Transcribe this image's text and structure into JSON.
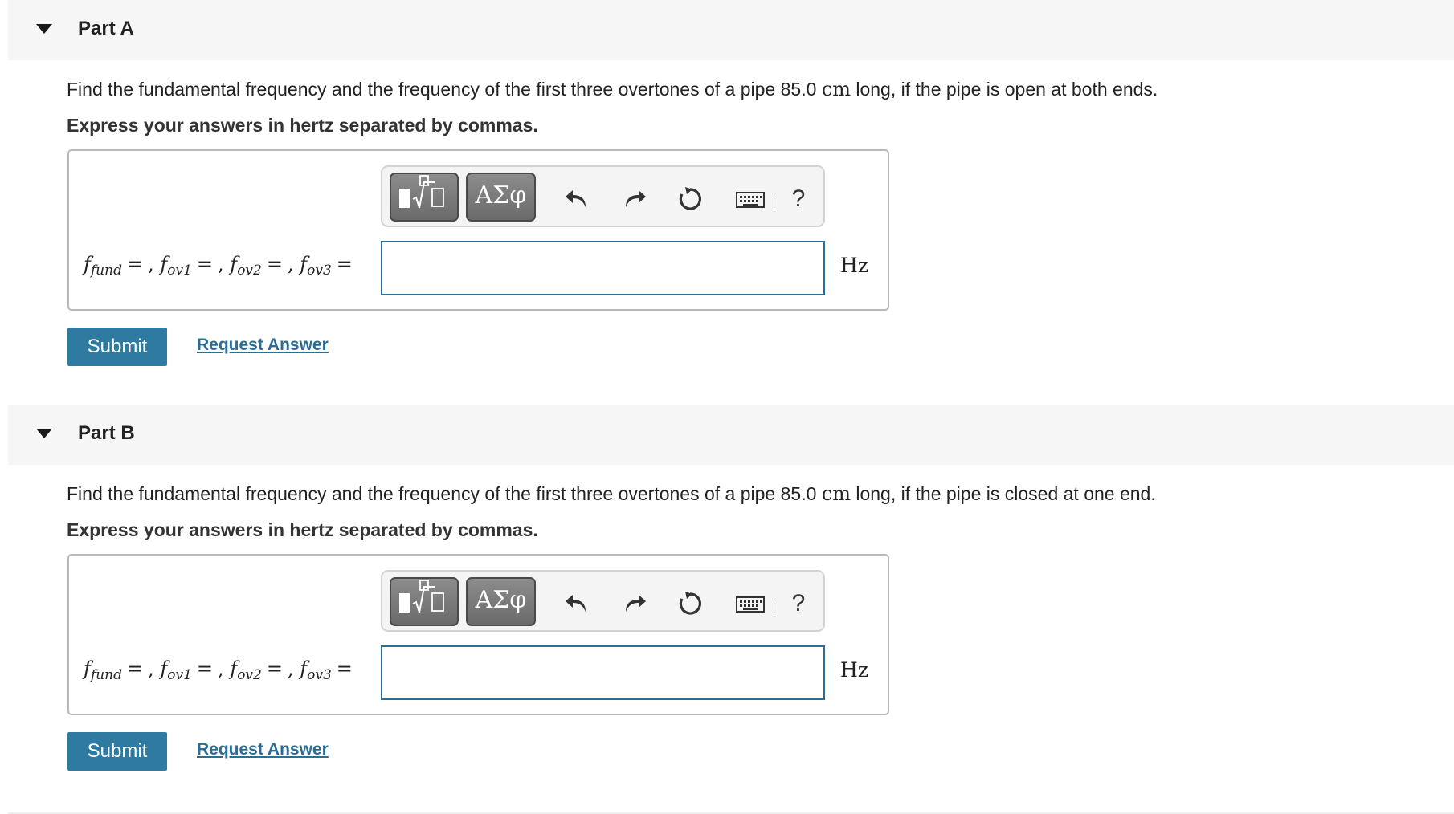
{
  "parts": [
    {
      "title": "Part A",
      "question_before": "Find the fundamental frequency and the frequency of the first three overtones of a pipe 85.0 ",
      "question_unit": "cm",
      "question_after": " long, if the pipe is open at both ends.",
      "instruction": "Express your answers in hertz separated by commas.",
      "toolbar": {
        "greek_label": "ΑΣφ",
        "help_label": "?"
      },
      "math": {
        "f": "f",
        "sub_fund": "fund",
        "sub_ov1": "ov1",
        "sub_ov2": "ov2",
        "sub_ov3": "ov3",
        "equals": "=",
        "comma": ","
      },
      "answer_value": "",
      "unit": "Hz",
      "submit_label": "Submit",
      "request_label": "Request Answer"
    },
    {
      "title": "Part B",
      "question_before": "Find the fundamental frequency and the frequency of the first three overtones of a pipe 85.0 ",
      "question_unit": "cm",
      "question_after": " long, if the pipe is closed at one end.",
      "instruction": "Express your answers in hertz separated by commas.",
      "toolbar": {
        "greek_label": "ΑΣφ",
        "help_label": "?"
      },
      "math": {
        "f": "f",
        "sub_fund": "fund",
        "sub_ov1": "ov1",
        "sub_ov2": "ov2",
        "sub_ov3": "ov3",
        "equals": "=",
        "comma": ","
      },
      "answer_value": "",
      "unit": "Hz",
      "submit_label": "Submit",
      "request_label": "Request Answer"
    }
  ],
  "colors": {
    "accent": "#2e7aa0",
    "link": "#2a6e94",
    "header_bg": "#f6f6f6",
    "toolbar_button": "#7a7a7a"
  },
  "icons": [
    "caret-down-icon",
    "templates-icon",
    "undo-icon",
    "redo-icon",
    "reset-icon",
    "keyboard-icon",
    "help-icon"
  ]
}
